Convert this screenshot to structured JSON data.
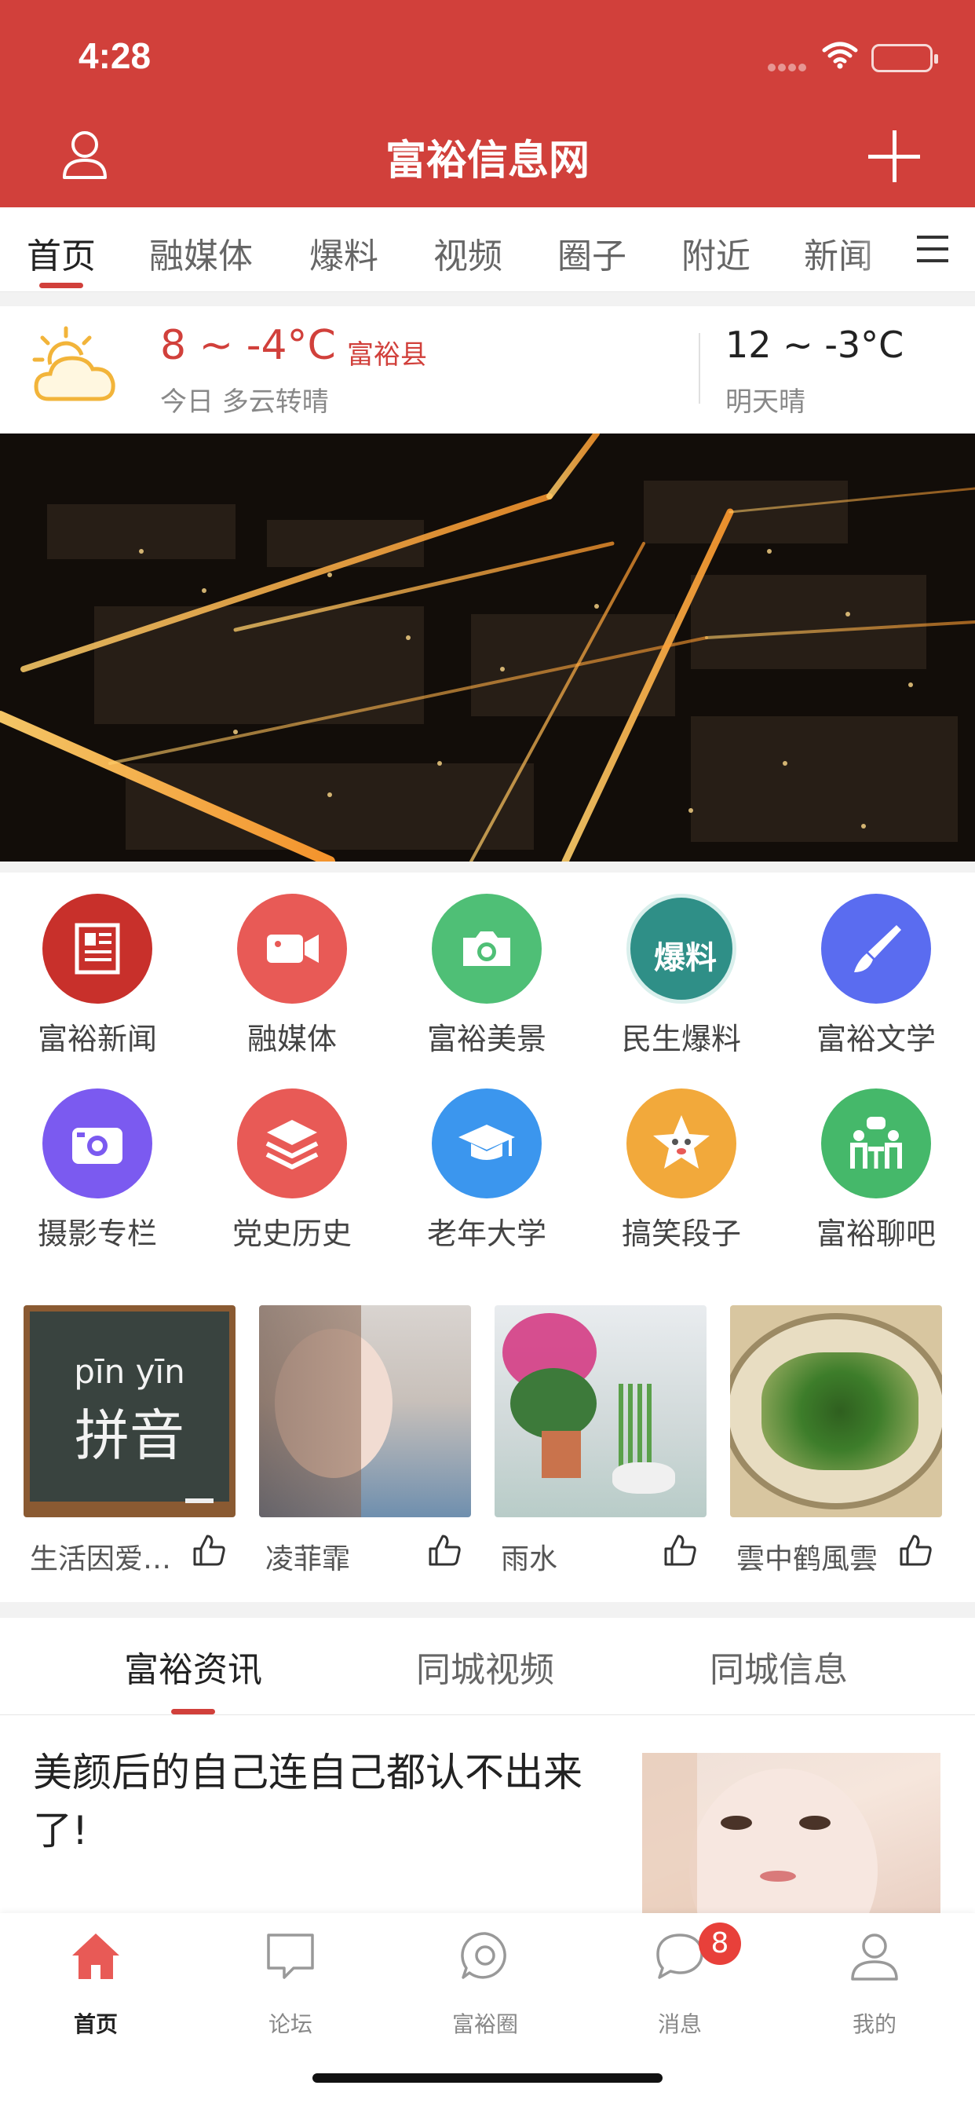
{
  "status_bar": {
    "time": "4:28"
  },
  "header": {
    "title": "富裕信息网"
  },
  "category_tabs": [
    "首页",
    "融媒体",
    "爆料",
    "视频",
    "圈子",
    "附近",
    "新闻"
  ],
  "weather": {
    "today_temp": "8 ~ -4°C",
    "location": "富裕县",
    "today_desc": "今日 多云转晴",
    "tomorrow_temp": "12 ~ -3°C",
    "tomorrow_desc": "明天晴"
  },
  "grid": [
    {
      "label": "富裕新闻",
      "icon": "newspaper-icon",
      "color": "#c8302b"
    },
    {
      "label": "融媒体",
      "icon": "video-camera-icon",
      "color": "#e85a56"
    },
    {
      "label": "富裕美景",
      "icon": "camera-icon",
      "color": "#4fbf76"
    },
    {
      "label": "民生爆料",
      "icon": "baoliao-icon",
      "color": "#2f8f87",
      "badge_text": "爆料"
    },
    {
      "label": "富裕文学",
      "icon": "brush-icon",
      "color": "#5a6cf0"
    },
    {
      "label": "摄影专栏",
      "icon": "photo-camera-icon",
      "color": "#7b5af0"
    },
    {
      "label": "党史历史",
      "icon": "layers-icon",
      "color": "#e85a56"
    },
    {
      "label": "老年大学",
      "icon": "graduation-cap-icon",
      "color": "#3b96ee"
    },
    {
      "label": "搞笑段子",
      "icon": "star-face-icon",
      "color": "#f2a93b"
    },
    {
      "label": "富裕聊吧",
      "icon": "chat-people-icon",
      "color": "#45b86a"
    }
  ],
  "cards": [
    {
      "name": "生活因爱…",
      "board_top": "pīn yīn",
      "board_main": "拼音"
    },
    {
      "name": "凌菲霏"
    },
    {
      "name": "雨水"
    },
    {
      "name": "雲中鹤風雲"
    }
  ],
  "news_tabs": [
    "富裕资讯",
    "同城视频",
    "同城信息"
  ],
  "article": {
    "title": "美颜后的自己连自己都认不出来了!"
  },
  "tabbar": [
    {
      "label": "首页",
      "icon": "home-icon"
    },
    {
      "label": "论坛",
      "icon": "forum-icon"
    },
    {
      "label": "富裕圈",
      "icon": "circle-chat-icon"
    },
    {
      "label": "消息",
      "icon": "message-icon",
      "badge": "8"
    },
    {
      "label": "我的",
      "icon": "profile-icon"
    }
  ],
  "colors": {
    "brand": "#d1403b"
  }
}
